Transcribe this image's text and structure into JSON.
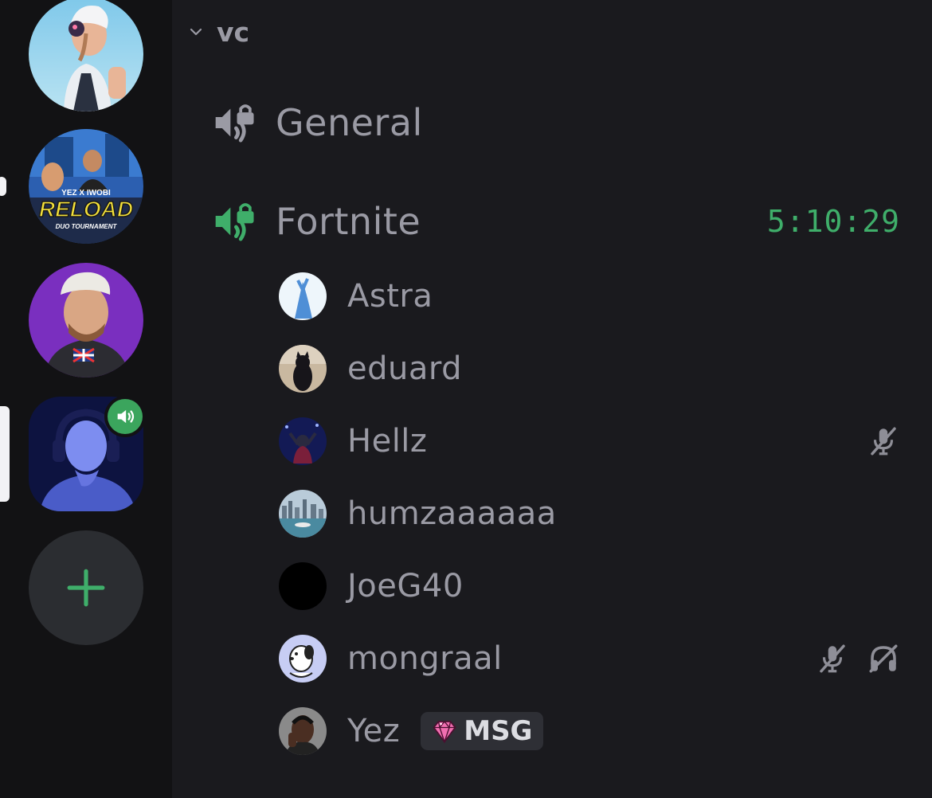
{
  "category": {
    "name": "vc",
    "expanded": true
  },
  "channels": [
    {
      "name": "General",
      "type": "voice-locked",
      "active": false
    },
    {
      "name": "Fortnite",
      "type": "voice-locked",
      "active": true,
      "timer": "5:10:29"
    }
  ],
  "members": [
    {
      "name": "Astra",
      "muted": false,
      "deafened": false
    },
    {
      "name": "eduard",
      "muted": false,
      "deafened": false
    },
    {
      "name": "Hellz",
      "muted": true,
      "deafened": false
    },
    {
      "name": "humzaaaaaa",
      "muted": false,
      "deafened": false
    },
    {
      "name": "JoeG40",
      "muted": false,
      "deafened": false
    },
    {
      "name": "mongraal",
      "muted": true,
      "deafened": true
    },
    {
      "name": "Yez",
      "muted": false,
      "deafened": false,
      "tag": {
        "icon": "gem-icon",
        "text": "MSG"
      }
    }
  ],
  "servers": [
    {
      "icon": "server-avatar-skin"
    },
    {
      "icon": "server-avatar-reload",
      "art_text": [
        "YEZ X IWOBI",
        "RELOAD",
        "DUO TOURNAMENT"
      ],
      "unread": true
    },
    {
      "icon": "server-avatar-purple"
    },
    {
      "icon": "server-avatar-headset",
      "selected": true,
      "voice_active": true
    }
  ],
  "colors": {
    "accent_green": "#3fae6a",
    "voice_badge": "#3ba55d",
    "text_muted": "#9a9aa4",
    "background": "#1a1a1e",
    "rail": "#121214"
  }
}
